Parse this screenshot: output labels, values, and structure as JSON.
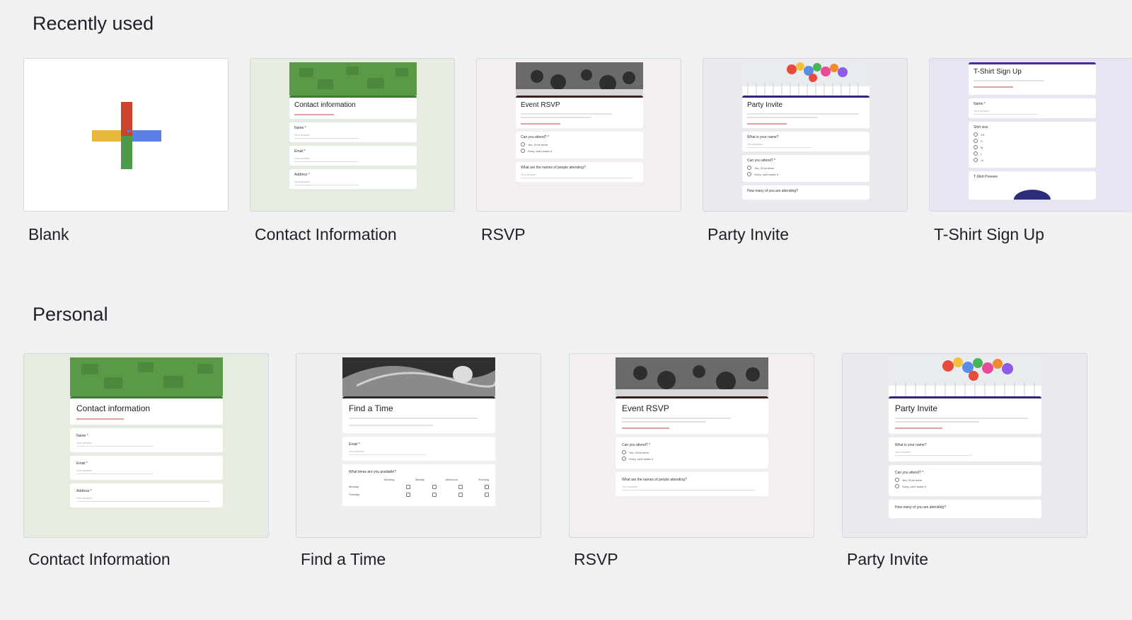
{
  "sections": {
    "recent": {
      "title": "Recently used"
    },
    "personal": {
      "title": "Personal"
    }
  },
  "templates": {
    "blank": {
      "label": "Blank"
    },
    "contact": {
      "label": "Contact Information",
      "form_title": "Contact information",
      "fields": [
        "Name *",
        "Email *",
        "Address *"
      ],
      "answer_placeholder": "Your answer",
      "accent": "#3c7a34",
      "bg": "#e6ecdf"
    },
    "rsvp": {
      "label": "RSVP",
      "form_title": "Event RSVP",
      "q1": "Can you attend? *",
      "opt1": "Yes, I'll be there",
      "opt2": "Sorry, can't make it",
      "q2": "What are the names of people attending?",
      "accent": "#3a1f1f",
      "bg": "#f3eff0"
    },
    "party": {
      "label": "Party Invite",
      "form_title": "Party Invite",
      "q1": "What is your name?",
      "q2": "Can you attend? *",
      "q3": "How many of you are attending?",
      "accent": "#31277a",
      "bg": "#e9e9ee"
    },
    "tshirt": {
      "label": "T-Shirt Sign Up",
      "form_title": "T-Shirt Sign Up",
      "q1": "Name *",
      "q2": "Shirt size",
      "sizes": [
        "XS",
        "S",
        "M",
        "L",
        "XL"
      ],
      "q3": "T-Shirt Preview",
      "accent": "#4a2b9a",
      "bg": "#e6e6f2"
    },
    "findtime": {
      "label": "Find a Time",
      "form_title": "Find a Time",
      "q1": "Email *",
      "q2": "What times are you available?",
      "cols": [
        "Morning",
        "Midday",
        "Afternoon",
        "Evening"
      ],
      "rows": [
        "Monday",
        "Tuesday"
      ],
      "accent": "#2b2b2b",
      "bg": "#efeff1"
    }
  },
  "colors": {
    "page_bg": "#f0f1f3",
    "plus_red": "#c8442c",
    "plus_yellow": "#e8b93c",
    "plus_blue": "#5b7fe6",
    "plus_green": "#4c9a4a"
  }
}
